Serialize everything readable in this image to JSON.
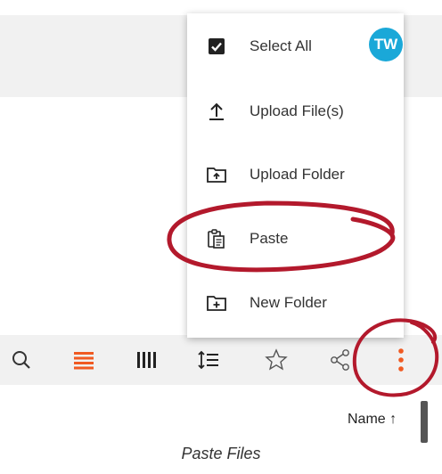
{
  "user": {
    "initials": "TW",
    "avatar_color": "#1aa8d8"
  },
  "menu": {
    "items": [
      {
        "label": "Select All",
        "icon": "checkbox-checked-icon"
      },
      {
        "label": "Upload File(s)",
        "icon": "upload-icon"
      },
      {
        "label": "Upload Folder",
        "icon": "folder-upload-icon"
      },
      {
        "label": "Paste",
        "icon": "clipboard-paste-icon"
      },
      {
        "label": "New Folder",
        "icon": "folder-add-icon"
      }
    ]
  },
  "toolbar": {
    "icons": [
      "search-icon",
      "list-view-icon",
      "column-view-icon",
      "sort-icon",
      "star-icon",
      "share-icon",
      "more-vertical-icon"
    ],
    "active_color": "#f05a22",
    "icon_color": "#333333"
  },
  "file_list": {
    "sort_column": "Name ↑"
  },
  "caption": "Paste Files",
  "annotation_color": "#b3192c"
}
